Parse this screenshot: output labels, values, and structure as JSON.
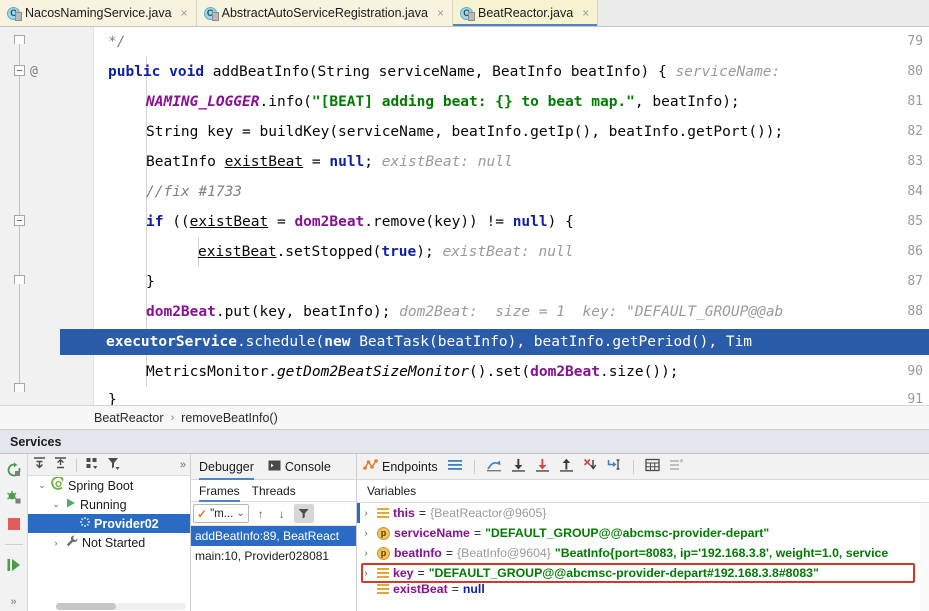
{
  "tabs": [
    {
      "label": "NacosNamingService.java",
      "icon": "java-class-icon",
      "active": false,
      "close": "×"
    },
    {
      "label": "AbstractAutoServiceRegistration.java",
      "icon": "java-class-icon",
      "active": false,
      "close": "×"
    },
    {
      "label": "BeatReactor.java",
      "icon": "java-class-icon",
      "active": true,
      "close": "×"
    }
  ],
  "editor": {
    "lines": [
      {
        "num": "79",
        "at": ""
      },
      {
        "num": "80",
        "at": "@"
      },
      {
        "num": "81",
        "at": ""
      },
      {
        "num": "82",
        "at": ""
      },
      {
        "num": "83",
        "at": ""
      },
      {
        "num": "84",
        "at": ""
      },
      {
        "num": "85",
        "at": ""
      },
      {
        "num": "86",
        "at": ""
      },
      {
        "num": "87",
        "at": ""
      },
      {
        "num": "88",
        "at": ""
      },
      {
        "num": "89",
        "at": ""
      },
      {
        "num": "90",
        "at": ""
      },
      {
        "num": "91",
        "at": ""
      }
    ],
    "code": {
      "l79_comment": "*/",
      "l80_public": "public",
      "l80_void": "void",
      "l80_sig": " addBeatInfo(String serviceName, BeatInfo beatInfo) { ",
      "l80_hint": "serviceName:",
      "l81_logger": "NAMING_LOGGER",
      "l81_info": ".info(",
      "l81_str": "\"[BEAT] adding beat: {} to beat map.\"",
      "l81_rest": ", beatInfo);",
      "l82": "String key = buildKey(serviceName, beatInfo.getIp(), beatInfo.getPort());",
      "l83_a": "BeatInfo ",
      "l83_var": "existBeat",
      "l83_eq": " = ",
      "l83_null": "null",
      "l83_semi": "; ",
      "l83_hint": "existBeat: null",
      "l84_comment": "//fix #1733",
      "l85_if": "if",
      "l85_a": " ((",
      "l85_var": "existBeat",
      "l85_b": " = ",
      "l85_fld": "dom2Beat",
      "l85_c": ".remove(key)) != ",
      "l85_null": "null",
      "l85_d": ") {",
      "l86_var": "existBeat",
      "l86_a": ".setStopped(",
      "l86_true": "true",
      "l86_b": "); ",
      "l86_hint": "existBeat: null",
      "l87": "}",
      "l88_fld": "dom2Beat",
      "l88_a": ".put(key, beatInfo); ",
      "l88_hint": "dom2Beat:  size = 1  key: \"DEFAULT_GROUP@@ab",
      "l89_fld": "executorService",
      "l89_a": ".schedule(",
      "l89_new": "new",
      "l89_b": " BeatTask(beatInfo), beatInfo.getPeriod(), Tim",
      "l90_a": "MetricsMonitor.",
      "l90_m": "getDom2BeatSizeMonitor",
      "l90_b": "().set(",
      "l90_fld": "dom2Beat",
      "l90_c": ".size());",
      "l91": "}"
    }
  },
  "breadcrumb": {
    "class": "BeatReactor",
    "separator": "›",
    "method": "removeBeatInfo()"
  },
  "services": {
    "title": "Services",
    "rail": [
      {
        "name": "rerun-icon",
        "glyph": "↻"
      },
      {
        "name": "rerun-debug-icon",
        "glyph": "☸"
      },
      {
        "name": "stop-icon",
        "glyph": "■"
      },
      {
        "name": "resume-program-icon",
        "glyph": "▶"
      }
    ],
    "rail_more": "»",
    "tree_toolbar": [
      {
        "name": "expand-all-icon",
        "glyph": "⤓"
      },
      {
        "name": "collapse-all-icon",
        "glyph": "⤒"
      },
      {
        "name": "group-by-icon",
        "glyph": "∷"
      },
      {
        "name": "filter-icon",
        "glyph": "▼"
      }
    ],
    "tree_more": "»",
    "tree": [
      {
        "label": "Spring Boot",
        "twisty": "⌄",
        "indent": 0,
        "icon": "spring-boot-icon",
        "selected": false
      },
      {
        "label": "Running",
        "twisty": "⌄",
        "indent": 1,
        "icon": "run-icon",
        "selected": false
      },
      {
        "label": "Provider02",
        "twisty": "",
        "indent": 2,
        "icon": "spinner-icon",
        "selected": true
      },
      {
        "label": "Not Started",
        "twisty": "›",
        "indent": 1,
        "icon": "wrench-icon",
        "selected": false
      }
    ]
  },
  "debugger": {
    "tabs": [
      {
        "label": "Debugger",
        "icon": "",
        "active": true
      },
      {
        "label": "Console",
        "icon": "console-icon",
        "active": false
      },
      {
        "label": "Endpoints",
        "icon": "endpoints-icon",
        "active": false
      }
    ],
    "sub_tabs": [
      {
        "label": "Frames",
        "active": true
      },
      {
        "label": "Threads",
        "active": false
      }
    ],
    "thread_selector": {
      "check": "✓",
      "value": "\"m...",
      "chevron": "⌄"
    },
    "frame_nav": [
      {
        "name": "frame-up-icon",
        "glyph": "↑"
      },
      {
        "name": "frame-down-icon",
        "glyph": "↓"
      },
      {
        "name": "frames-filter-icon",
        "glyph": "▼"
      }
    ],
    "frames": [
      {
        "label": "addBeatInfo:89, BeatReact",
        "selected": true
      },
      {
        "label": "main:10, Provider028081",
        "selected": false
      }
    ],
    "toolbar_icons": [
      {
        "name": "menu-icon",
        "glyph": "≡"
      },
      {
        "name": "show-execution-point-icon",
        "glyph": "⤴"
      },
      {
        "name": "step-over-icon",
        "glyph": "⤓"
      },
      {
        "name": "step-into-icon",
        "glyph": "⤓"
      },
      {
        "name": "step-out-icon",
        "glyph": "⤒"
      },
      {
        "name": "force-step-into-icon",
        "glyph": "✗"
      },
      {
        "name": "run-to-cursor-icon",
        "glyph": "↴"
      },
      {
        "name": "evaluate-expression-icon",
        "glyph": "▦"
      },
      {
        "name": "settings-icon",
        "glyph": "☲"
      }
    ],
    "variables_label": "Variables",
    "variables": [
      {
        "twisty": "›",
        "badge": "list",
        "name": "this",
        "eq": " = ",
        "ref": "{BeatReactor@9605}",
        "value": "",
        "value_type": "ref",
        "highlighted": false
      },
      {
        "twisty": "›",
        "badge": "p",
        "name": "serviceName",
        "eq": " = ",
        "ref": "",
        "value": "\"DEFAULT_GROUP@@abcmsc-provider-depart\"",
        "value_type": "str",
        "highlighted": false
      },
      {
        "twisty": "›",
        "badge": "p",
        "name": "beatInfo",
        "eq": " = ",
        "ref": "{BeatInfo@9604}",
        "value": "\"BeatInfo{port=8083, ip='192.168.3.8', weight=1.0, service",
        "value_type": "str",
        "highlighted": false
      },
      {
        "twisty": "›",
        "badge": "list",
        "name": "key",
        "eq": " = ",
        "ref": "",
        "value": "\"DEFAULT_GROUP@@abcmsc-provider-depart#192.168.3.8#8083\"",
        "value_type": "str",
        "highlighted": true
      },
      {
        "twisty": "",
        "badge": "list",
        "name": "existBeat",
        "eq": " = ",
        "ref": "",
        "value": "null",
        "value_type": "null",
        "highlighted": false
      }
    ]
  },
  "colors": {
    "accent": "#4a86c8",
    "selection": "#2a6cc4",
    "highlight_box": "#d03a2d",
    "string": "#017b01",
    "keyword": "#0d1fa8",
    "field": "#871094",
    "comment": "#808080"
  }
}
